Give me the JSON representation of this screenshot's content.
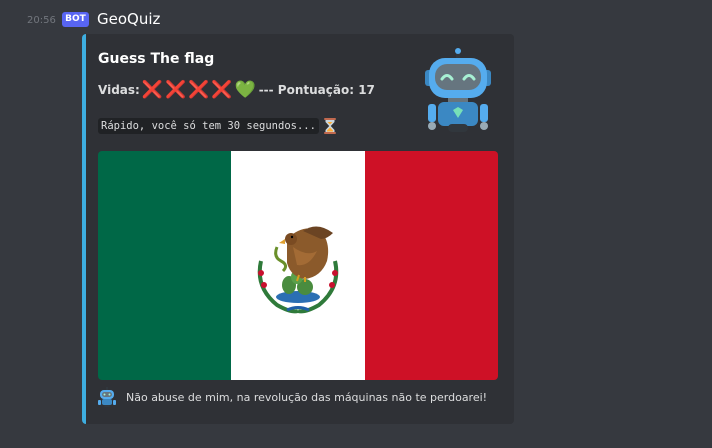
{
  "message": {
    "timestamp": "20:56",
    "bot_tag": "BOT",
    "username": "GeoQuiz"
  },
  "embed": {
    "accent_color": "#3eaee0",
    "title": "Guess The flag",
    "lives_label": "Vidas:",
    "lives_icons": [
      "cross-mark",
      "cross-mark",
      "cross-mark",
      "cross-mark",
      "green-heart"
    ],
    "cross_glyph": "❌",
    "heart_glyph": "💚",
    "score_text": "--- Pontuação: 17",
    "timer_text": "Rápido, você só tem 30 segundos...",
    "timer_icon": "hourglass-icon",
    "image": {
      "subject": "flag-of-mexico",
      "colors": [
        "#006847",
        "#ffffff",
        "#ce1126"
      ]
    },
    "footer_text": "Não abuse de mim, na revolução das máquinas não te perdoarei!"
  }
}
